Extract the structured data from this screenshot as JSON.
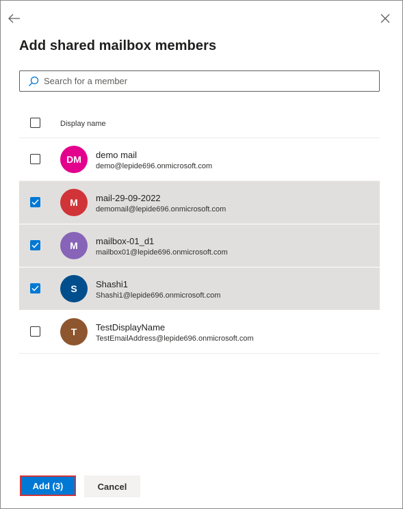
{
  "panel": {
    "title": "Add shared mailbox members",
    "back_icon": "arrow-left-icon",
    "close_icon": "close-icon"
  },
  "search": {
    "placeholder": "Search for a member",
    "value": ""
  },
  "table": {
    "column_header": "Display name",
    "rows": [
      {
        "initials": "DM",
        "name": "demo mail",
        "email": "demo@lepide696.onmicrosoft.com",
        "avatar_color": "#e3008c",
        "checked": false
      },
      {
        "initials": "M",
        "name": "mail-29-09-2022",
        "email": "demomail@lepide696.onmicrosoft.com",
        "avatar_color": "#d13438",
        "checked": true
      },
      {
        "initials": "M",
        "name": "mailbox-01_d1",
        "email": "mailbox01@lepide696.onmicrosoft.com",
        "avatar_color": "#8764b8",
        "checked": true
      },
      {
        "initials": "S",
        "name": "Shashi1",
        "email": "Shashi1@lepide696.onmicrosoft.com",
        "avatar_color": "#004e8c",
        "checked": true
      },
      {
        "initials": "T",
        "name": "TestDisplayName",
        "email": "TestEmailAddress@lepide696.onmicrosoft.com",
        "avatar_color": "#8e562e",
        "checked": false
      }
    ]
  },
  "footer": {
    "add_label": "Add (3)",
    "cancel_label": "Cancel"
  },
  "colors": {
    "accent": "#0078d4",
    "selected_row": "#e1dfdd",
    "highlight_border": "#d13438"
  }
}
